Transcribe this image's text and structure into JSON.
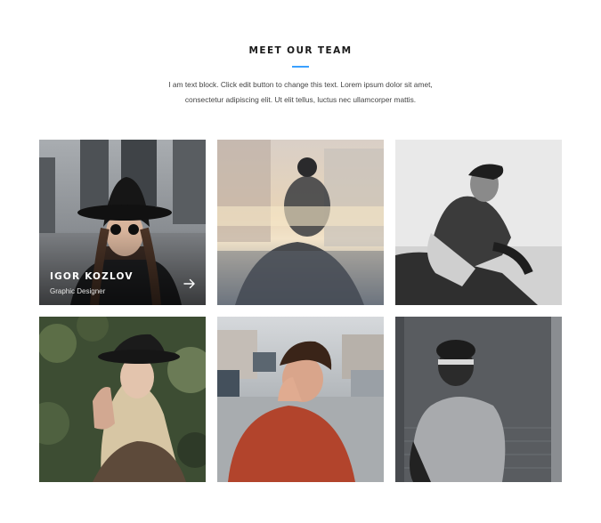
{
  "section": {
    "title": "MEET OUR TEAM",
    "intro_line1": "I am text block. Click edit button to change this text. Lorem ipsum dolor sit amet,",
    "intro_line2": "consectetur adipiscing elit. Ut elit tellus, luctus nec ullamcorper mattis.",
    "accent_color": "#3aa0ff"
  },
  "team": [
    {
      "name": "IGOR KOZLOV",
      "role": "Graphic Designer",
      "photo": "woman in black hat and round sunglasses",
      "link_icon": "arrow-right-icon"
    },
    {
      "photo": "double exposure portrait with city skyline"
    },
    {
      "photo": "man with hoodie sitting, black and white"
    },
    {
      "photo": "blonde woman in black hat among leaves"
    },
    {
      "photo": "man in red sweater on street, hand on head"
    },
    {
      "photo": "person in grey hoodie sitting on stairs"
    }
  ]
}
